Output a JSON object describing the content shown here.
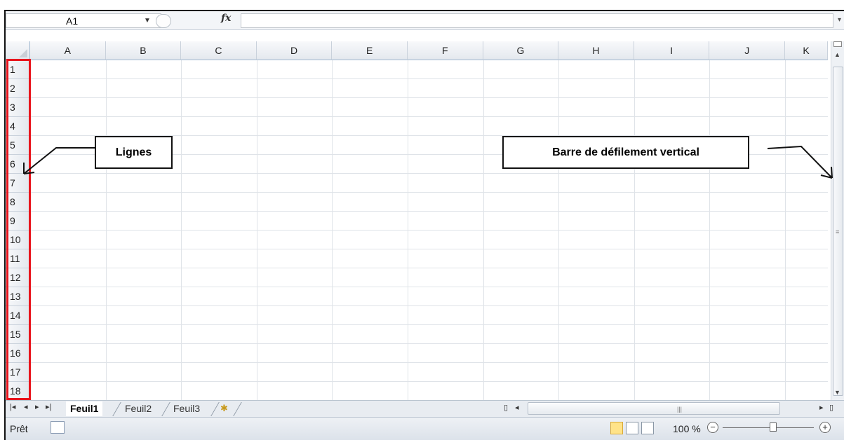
{
  "formula_bar": {
    "name_box_value": "A1",
    "fx_label": "fx"
  },
  "columns": [
    "A",
    "B",
    "C",
    "D",
    "E",
    "F",
    "G",
    "H",
    "I",
    "J",
    "K"
  ],
  "rows": [
    "1",
    "2",
    "3",
    "4",
    "5",
    "6",
    "7",
    "8",
    "9",
    "10",
    "11",
    "12",
    "13",
    "14",
    "15",
    "16",
    "17",
    "18"
  ],
  "sheet_tabs": {
    "tabs": [
      "Feuil1",
      "Feuil2",
      "Feuil3"
    ],
    "active": "Feuil1"
  },
  "status_bar": {
    "status": "Prêt",
    "zoom": "100 %"
  },
  "annotations": {
    "rows_label": "Lignes",
    "vscroll_label": "Barre de défilement vertical"
  },
  "colors": {
    "highlight_red": "#e8141c",
    "header_border": "#9eb6ce"
  }
}
